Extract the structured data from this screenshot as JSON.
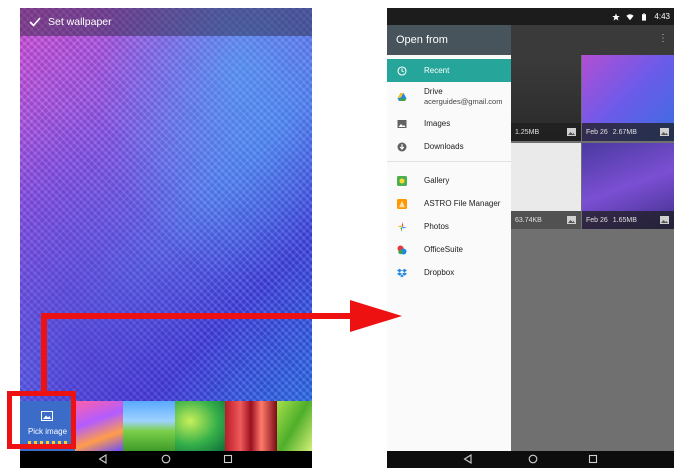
{
  "left_screen": {
    "header_title": "Set wallpaper",
    "pick_image_label": "Pick image"
  },
  "right_screen": {
    "status_time": "4:43",
    "drawer_title": "Open from",
    "drawer_items": [
      {
        "label": "Recent",
        "icon": "clock-icon",
        "selected": true
      },
      {
        "label": "Drive",
        "sub": "acerguides@gmail.com",
        "icon": "drive-icon"
      },
      {
        "label": "Images",
        "icon": "image-icon"
      },
      {
        "label": "Downloads",
        "icon": "download-icon"
      },
      {
        "label": "Gallery",
        "icon": "gallery-icon"
      },
      {
        "label": "ASTRO File Manager",
        "icon": "astro-icon"
      },
      {
        "label": "Photos",
        "icon": "photos-icon"
      },
      {
        "label": "OfficeSuite",
        "icon": "officesuite-icon"
      },
      {
        "label": "Dropbox",
        "icon": "dropbox-icon"
      }
    ],
    "cards": [
      {
        "size": "1.25MB"
      },
      {
        "date": "Feb 26",
        "size": "2.67MB"
      },
      {
        "size": "63.74KB"
      },
      {
        "date": "Feb 26",
        "size": "1.65MB"
      }
    ]
  },
  "colors": {
    "highlight": "#ee1111",
    "drawer_selected": "#26a69a",
    "drawer_header": "#48545b"
  }
}
